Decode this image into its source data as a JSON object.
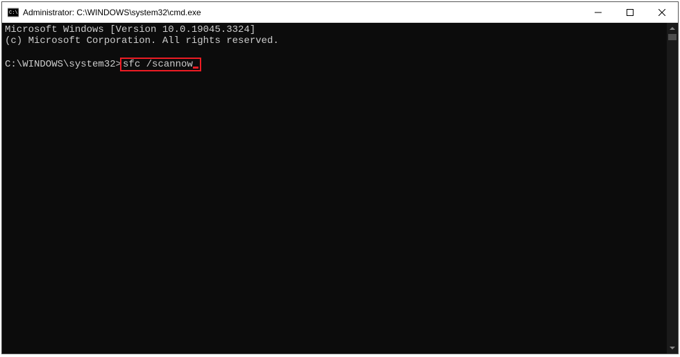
{
  "window": {
    "title": "Administrator: C:\\WINDOWS\\system32\\cmd.exe"
  },
  "console": {
    "line1": "Microsoft Windows [Version 10.0.19045.3324]",
    "line2": "(c) Microsoft Corporation. All rights reserved.",
    "prompt": "C:\\WINDOWS\\system32>",
    "command": "sfc /scannow"
  },
  "highlight": {
    "color": "#ed1c24"
  }
}
